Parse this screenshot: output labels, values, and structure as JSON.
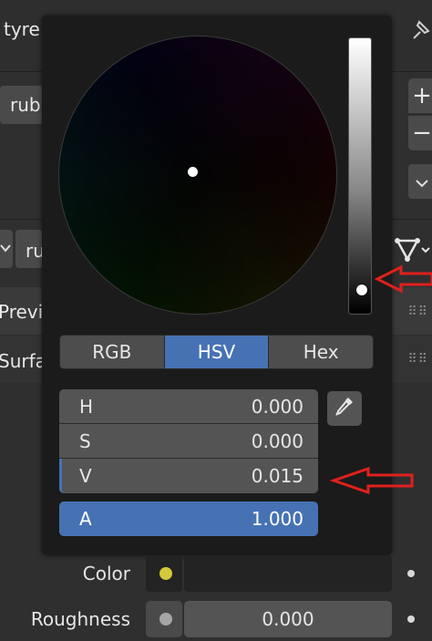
{
  "background": {
    "name_text": "tyre",
    "material_text": "rub",
    "slot_text": "ru",
    "preview_text": "Previ",
    "surface_text": "Surfa",
    "plus_label": "+",
    "minus_label": "−"
  },
  "picker": {
    "modes": [
      {
        "label": "RGB",
        "active": false
      },
      {
        "label": "HSV",
        "active": true
      },
      {
        "label": "Hex",
        "active": false
      }
    ],
    "fields": [
      {
        "label": "H",
        "value": "0.000"
      },
      {
        "label": "S",
        "value": "0.000"
      },
      {
        "label": "V",
        "value": "0.015"
      }
    ],
    "alpha": {
      "label": "A",
      "value": "1.000"
    },
    "value_level": 0.015
  },
  "properties": {
    "color_label": "Color",
    "roughness_label": "Roughness",
    "roughness_value": "0.000"
  },
  "colors": {
    "accent": "#4672b4",
    "annotation": "#e0201c",
    "color_dot": "#d4c93a"
  },
  "icons": [
    "pin-icon",
    "chevron-down-icon",
    "node-tree-icon",
    "eyedropper-icon",
    "grip-icon"
  ]
}
